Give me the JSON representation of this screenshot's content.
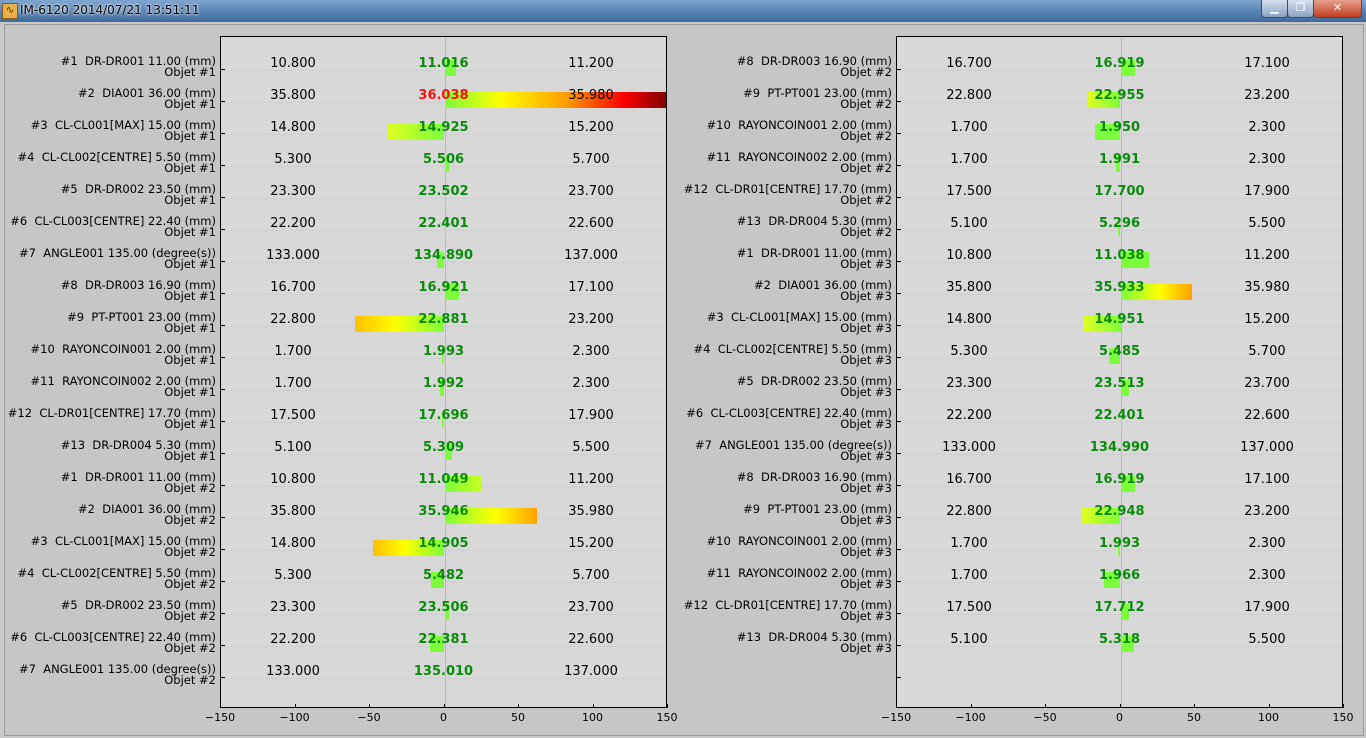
{
  "window": {
    "title": "IM-6120 2014/07/21 13:51:11",
    "min_label": "▁",
    "max_label": "❐",
    "close_label": "✕",
    "app_icon": "waveform-icon"
  },
  "axis": {
    "ticks": [
      "−150",
      "−100",
      "−50",
      "0",
      "50",
      "100",
      "150"
    ],
    "range": [
      -150,
      150
    ]
  },
  "panels": [
    {
      "rows": [
        {
          "name": "#1  DR-DR001 11.00 (mm)",
          "obj": "Objet #1",
          "lo": "10.800",
          "meas": "11.016",
          "hi": "11.200",
          "dev": 8,
          "status": "ok"
        },
        {
          "name": "#2  DIA001 36.00 (mm)",
          "obj": "Objet #1",
          "lo": "35.800",
          "meas": "36.038",
          "hi": "35.980",
          "dev": 150,
          "status": "bad"
        },
        {
          "name": "#3  CL-CL001[MAX] 15.00 (mm)",
          "obj": "Objet #1",
          "lo": "14.800",
          "meas": "14.925",
          "hi": "15.200",
          "dev": -38,
          "status": "ok"
        },
        {
          "name": "#4  CL-CL002[CENTRE] 5.50 (mm)",
          "obj": "Objet #1",
          "lo": "5.300",
          "meas": "5.506",
          "hi": "5.700",
          "dev": 3,
          "status": "ok"
        },
        {
          "name": "#5  DR-DR002 23.50 (mm)",
          "obj": "Objet #1",
          "lo": "23.300",
          "meas": "23.502",
          "hi": "23.700",
          "dev": 1,
          "status": "ok"
        },
        {
          "name": "#6  CL-CL003[CENTRE] 22.40 (mm)",
          "obj": "Objet #1",
          "lo": "22.200",
          "meas": "22.401",
          "hi": "22.600",
          "dev": 1,
          "status": "ok"
        },
        {
          "name": "#7  ANGLE001 135.00 (degree(s))",
          "obj": "Objet #1",
          "lo": "133.000",
          "meas": "134.890",
          "hi": "137.000",
          "dev": -5,
          "status": "ok"
        },
        {
          "name": "#8  DR-DR003 16.90 (mm)",
          "obj": "Objet #1",
          "lo": "16.700",
          "meas": "16.921",
          "hi": "17.100",
          "dev": 10,
          "status": "ok"
        },
        {
          "name": "#9  PT-PT001 23.00 (mm)",
          "obj": "Objet #1",
          "lo": "22.800",
          "meas": "22.881",
          "hi": "23.200",
          "dev": -60,
          "status": "ok"
        },
        {
          "name": "#10  RAYONCOIN001 2.00 (mm)",
          "obj": "Objet #1",
          "lo": "1.700",
          "meas": "1.993",
          "hi": "2.300",
          "dev": -2,
          "status": "ok"
        },
        {
          "name": "#11  RAYONCOIN002 2.00 (mm)",
          "obj": "Objet #1",
          "lo": "1.700",
          "meas": "1.992",
          "hi": "2.300",
          "dev": -3,
          "status": "ok"
        },
        {
          "name": "#12  CL-DR01[CENTRE] 17.70 (mm)",
          "obj": "Objet #1",
          "lo": "17.500",
          "meas": "17.696",
          "hi": "17.900",
          "dev": -2,
          "status": "ok"
        },
        {
          "name": "#13  DR-DR004 5.30 (mm)",
          "obj": "Objet #1",
          "lo": "5.100",
          "meas": "5.309",
          "hi": "5.500",
          "dev": 5,
          "status": "ok"
        },
        {
          "name": "#1  DR-DR001 11.00 (mm)",
          "obj": "Objet #2",
          "lo": "10.800",
          "meas": "11.049",
          "hi": "11.200",
          "dev": 25,
          "status": "ok"
        },
        {
          "name": "#2  DIA001 36.00 (mm)",
          "obj": "Objet #2",
          "lo": "35.800",
          "meas": "35.946",
          "hi": "35.980",
          "dev": 62,
          "status": "ok"
        },
        {
          "name": "#3  CL-CL001[MAX] 15.00 (mm)",
          "obj": "Objet #2",
          "lo": "14.800",
          "meas": "14.905",
          "hi": "15.200",
          "dev": -48,
          "status": "ok"
        },
        {
          "name": "#4  CL-CL002[CENTRE] 5.50 (mm)",
          "obj": "Objet #2",
          "lo": "5.300",
          "meas": "5.482",
          "hi": "5.700",
          "dev": -9,
          "status": "ok"
        },
        {
          "name": "#5  DR-DR002 23.50 (mm)",
          "obj": "Objet #2",
          "lo": "23.300",
          "meas": "23.506",
          "hi": "23.700",
          "dev": 3,
          "status": "ok"
        },
        {
          "name": "#6  CL-CL003[CENTRE] 22.40 (mm)",
          "obj": "Objet #2",
          "lo": "22.200",
          "meas": "22.381",
          "hi": "22.600",
          "dev": -10,
          "status": "ok"
        },
        {
          "name": "#7  ANGLE001 135.00 (degree(s))",
          "obj": "Objet #2",
          "lo": "133.000",
          "meas": "135.010",
          "hi": "137.000",
          "dev": 0,
          "status": "ok"
        }
      ]
    },
    {
      "rows": [
        {
          "name": "#8  DR-DR003 16.90 (mm)",
          "obj": "Objet #2",
          "lo": "16.700",
          "meas": "16.919",
          "hi": "17.100",
          "dev": 10,
          "status": "ok"
        },
        {
          "name": "#9  PT-PT001 23.00 (mm)",
          "obj": "Objet #2",
          "lo": "22.800",
          "meas": "22.955",
          "hi": "23.200",
          "dev": -22,
          "status": "ok"
        },
        {
          "name": "#10  RAYONCOIN001 2.00 (mm)",
          "obj": "Objet #2",
          "lo": "1.700",
          "meas": "1.950",
          "hi": "2.300",
          "dev": -17,
          "status": "ok"
        },
        {
          "name": "#11  RAYONCOIN002 2.00 (mm)",
          "obj": "Objet #2",
          "lo": "1.700",
          "meas": "1.991",
          "hi": "2.300",
          "dev": -3,
          "status": "ok"
        },
        {
          "name": "#12  CL-DR01[CENTRE] 17.70 (mm)",
          "obj": "Objet #2",
          "lo": "17.500",
          "meas": "17.700",
          "hi": "17.900",
          "dev": 0,
          "status": "ok"
        },
        {
          "name": "#13  DR-DR004 5.30 (mm)",
          "obj": "Objet #2",
          "lo": "5.100",
          "meas": "5.296",
          "hi": "5.500",
          "dev": -2,
          "status": "ok"
        },
        {
          "name": "#1  DR-DR001 11.00 (mm)",
          "obj": "Objet #3",
          "lo": "10.800",
          "meas": "11.038",
          "hi": "11.200",
          "dev": 19,
          "status": "ok"
        },
        {
          "name": "#2  DIA001 36.00 (mm)",
          "obj": "Objet #3",
          "lo": "35.800",
          "meas": "35.933",
          "hi": "35.980",
          "dev": 48,
          "status": "ok"
        },
        {
          "name": "#3  CL-CL001[MAX] 15.00 (mm)",
          "obj": "Objet #3",
          "lo": "14.800",
          "meas": "14.951",
          "hi": "15.200",
          "dev": -25,
          "status": "ok"
        },
        {
          "name": "#4  CL-CL002[CENTRE] 5.50 (mm)",
          "obj": "Objet #3",
          "lo": "5.300",
          "meas": "5.485",
          "hi": "5.700",
          "dev": -8,
          "status": "ok"
        },
        {
          "name": "#5  DR-DR002 23.50 (mm)",
          "obj": "Objet #3",
          "lo": "23.300",
          "meas": "23.513",
          "hi": "23.700",
          "dev": 6,
          "status": "ok"
        },
        {
          "name": "#6  CL-CL003[CENTRE] 22.40 (mm)",
          "obj": "Objet #3",
          "lo": "22.200",
          "meas": "22.401",
          "hi": "22.600",
          "dev": 1,
          "status": "ok"
        },
        {
          "name": "#7  ANGLE001 135.00 (degree(s))",
          "obj": "Objet #3",
          "lo": "133.000",
          "meas": "134.990",
          "hi": "137.000",
          "dev": 0,
          "status": "ok"
        },
        {
          "name": "#8  DR-DR003 16.90 (mm)",
          "obj": "Objet #3",
          "lo": "16.700",
          "meas": "16.919",
          "hi": "17.100",
          "dev": 10,
          "status": "ok"
        },
        {
          "name": "#9  PT-PT001 23.00 (mm)",
          "obj": "Objet #3",
          "lo": "22.800",
          "meas": "22.948",
          "hi": "23.200",
          "dev": -26,
          "status": "ok"
        },
        {
          "name": "#10  RAYONCOIN001 2.00 (mm)",
          "obj": "Objet #3",
          "lo": "1.700",
          "meas": "1.993",
          "hi": "2.300",
          "dev": -2,
          "status": "ok"
        },
        {
          "name": "#11  RAYONCOIN002 2.00 (mm)",
          "obj": "Objet #3",
          "lo": "1.700",
          "meas": "1.966",
          "hi": "2.300",
          "dev": -11,
          "status": "ok"
        },
        {
          "name": "#12  CL-DR01[CENTRE] 17.70 (mm)",
          "obj": "Objet #3",
          "lo": "17.500",
          "meas": "17.712",
          "hi": "17.900",
          "dev": 6,
          "status": "ok"
        },
        {
          "name": "#13  DR-DR004 5.30 (mm)",
          "obj": "Objet #3",
          "lo": "5.100",
          "meas": "5.318",
          "hi": "5.500",
          "dev": 9,
          "status": "ok"
        }
      ]
    }
  ],
  "colors": {
    "ok": "#0a8a0a",
    "bad": "#ff1010",
    "plot_bg": "#d8d8d8"
  }
}
